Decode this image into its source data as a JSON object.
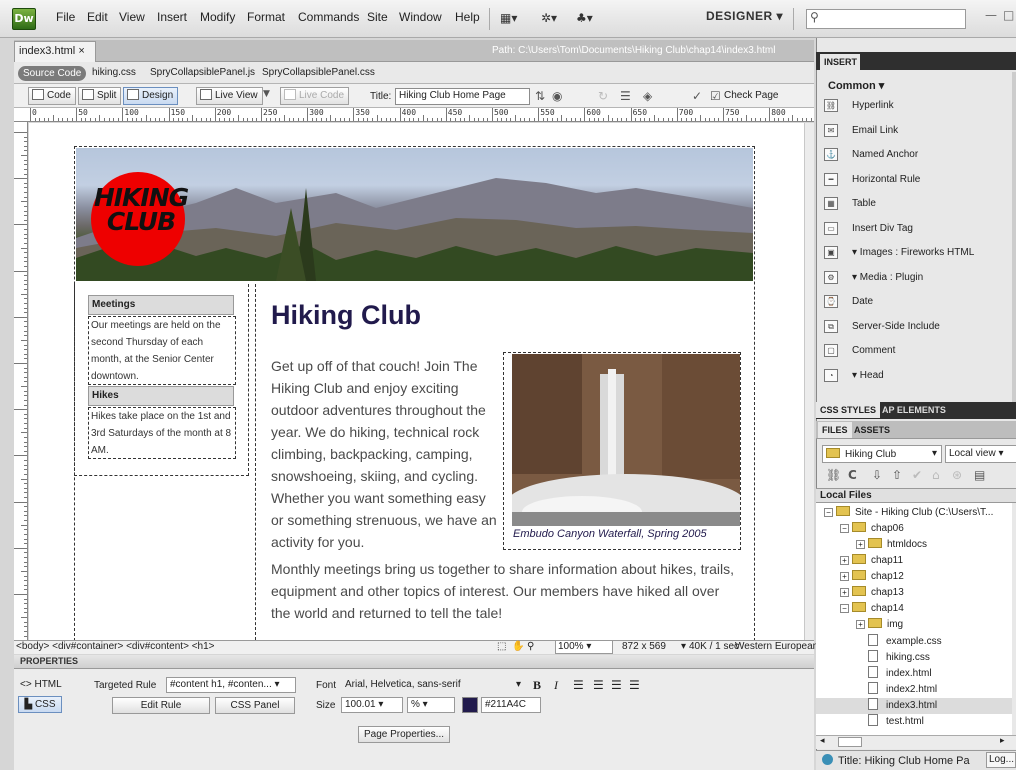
{
  "app": {
    "logo": "Dw",
    "menu": [
      "File",
      "Edit",
      "View",
      "Insert",
      "Modify",
      "Format",
      "Commands",
      "Site",
      "Window",
      "Help"
    ],
    "workspace": "DESIGNER ▾"
  },
  "document": {
    "tab": "index3.html",
    "tab_close": "×",
    "path": "Path: C:\\Users\\Tom\\Documents\\Hiking Club\\chap14\\index3.html",
    "related_files": [
      "Source Code",
      "hiking.css",
      "SpryCollapsiblePanel.js",
      "SpryCollapsiblePanel.css"
    ],
    "toolbar": {
      "code": "Code",
      "split": "Split",
      "design": "Design",
      "live_view": "Live View",
      "live_code": "Live Code",
      "title_label": "Title:",
      "title_value": "Hiking Club Home Page",
      "check_page": "Check Page"
    }
  },
  "ruler": {
    "h_labels": [
      "0",
      "50",
      "100",
      "150",
      "200",
      "250",
      "300",
      "350",
      "400",
      "450",
      "500",
      "550",
      "600",
      "650",
      "700",
      "750",
      "800",
      "850"
    ]
  },
  "page": {
    "logo_text": "HIKING CLUB",
    "sidebar": [
      {
        "heading": "Meetings",
        "text": "Our meetings are held on the second Thursday of each month, at the Senior Center downtown."
      },
      {
        "heading": "Hikes",
        "text": "Hikes take place on the 1st and 3rd Saturdays of the month at 8 AM."
      }
    ],
    "h1": "Hiking Club",
    "intro": "Get up off of that couch! Join The Hiking Club and enjoy exciting outdoor adventures throughout the year. We do hiking, technical rock climbing, backpacking, camping, snowshoeing, skiing, and cycling. Whether you want something easy or something strenuous, we have an activity for you.",
    "caption": "Embudo Canyon Waterfall, Spring 2005",
    "body2": "Monthly meetings bring us together to share information about hikes, trails, equipment and other topics of interest. Our members have hiked all over the world and returned to tell the tale!"
  },
  "statusbar": {
    "tags": "<body> <div#container> <div#content> <h1>",
    "zoom": "100%",
    "size": "872 x 569",
    "download": "40K / 1 sec",
    "encoding": "Western European"
  },
  "properties": {
    "title": "PROPERTIES",
    "html_label": "HTML",
    "css_label": "CSS",
    "targeted_rule_label": "Targeted Rule",
    "targeted_rule_value": "#content h1, #conten...",
    "edit_rule": "Edit Rule",
    "css_panel": "CSS Panel",
    "font_label": "Font",
    "font_value": "Arial, Helvetica, sans-serif",
    "size_label": "Size",
    "size_value": "100.01",
    "size_unit": "%",
    "color_value": "#211A4C",
    "page_properties": "Page Properties..."
  },
  "insert_panel": {
    "tab": "INSERT",
    "category": "Common ▾",
    "items": [
      {
        "label": "Hyperlink",
        "icon": "hyperlink-icon"
      },
      {
        "label": "Email Link",
        "icon": "email-link-icon"
      },
      {
        "label": "Named Anchor",
        "icon": "anchor-icon"
      },
      {
        "label": "Horizontal Rule",
        "icon": "horizontal-rule-icon"
      },
      {
        "label": "Table",
        "icon": "table-icon"
      },
      {
        "label": "Insert Div Tag",
        "icon": "div-tag-icon"
      },
      {
        "label": "▾ Images : Fireworks HTML",
        "icon": "image-icon"
      },
      {
        "label": "▾ Media : Plugin",
        "icon": "media-icon"
      },
      {
        "label": "Date",
        "icon": "date-icon"
      },
      {
        "label": "Server-Side Include",
        "icon": "ssi-icon"
      },
      {
        "label": "Comment",
        "icon": "comment-icon"
      },
      {
        "label": "▾ Head",
        "icon": "head-icon"
      }
    ]
  },
  "panels": {
    "css_styles": "CSS STYLES",
    "ap_elements": "AP ELEMENTS",
    "files": "FILES",
    "assets": "ASSETS",
    "site": "Hiking Club",
    "view": "Local view",
    "local_files": "Local Files",
    "tree": [
      {
        "label": "Site - Hiking Club (C:\\Users\\T...",
        "type": "folder",
        "indent": 0,
        "exp": "−"
      },
      {
        "label": "chap06",
        "type": "folder",
        "indent": 1,
        "exp": "−"
      },
      {
        "label": "htmldocs",
        "type": "folder",
        "indent": 2,
        "exp": "+"
      },
      {
        "label": "chap11",
        "type": "folder",
        "indent": 1,
        "exp": "+"
      },
      {
        "label": "chap12",
        "type": "folder",
        "indent": 1,
        "exp": "+"
      },
      {
        "label": "chap13",
        "type": "folder",
        "indent": 1,
        "exp": "+"
      },
      {
        "label": "chap14",
        "type": "folder",
        "indent": 1,
        "exp": "−"
      },
      {
        "label": "img",
        "type": "folder",
        "indent": 2,
        "exp": "+"
      },
      {
        "label": "example.css",
        "type": "file",
        "indent": 2,
        "exp": ""
      },
      {
        "label": "hiking.css",
        "type": "file",
        "indent": 2,
        "exp": ""
      },
      {
        "label": "index.html",
        "type": "file",
        "indent": 2,
        "exp": ""
      },
      {
        "label": "index2.html",
        "type": "file",
        "indent": 2,
        "exp": ""
      },
      {
        "label": "index3.html",
        "type": "file",
        "indent": 2,
        "exp": "",
        "selected": true
      },
      {
        "label": "test.html",
        "type": "file",
        "indent": 2,
        "exp": ""
      }
    ],
    "status_title": "Title: Hiking Club Home Pa",
    "log": "Log..."
  },
  "colors": {
    "heading": "#211A4C",
    "logo_red": "#e00000"
  }
}
